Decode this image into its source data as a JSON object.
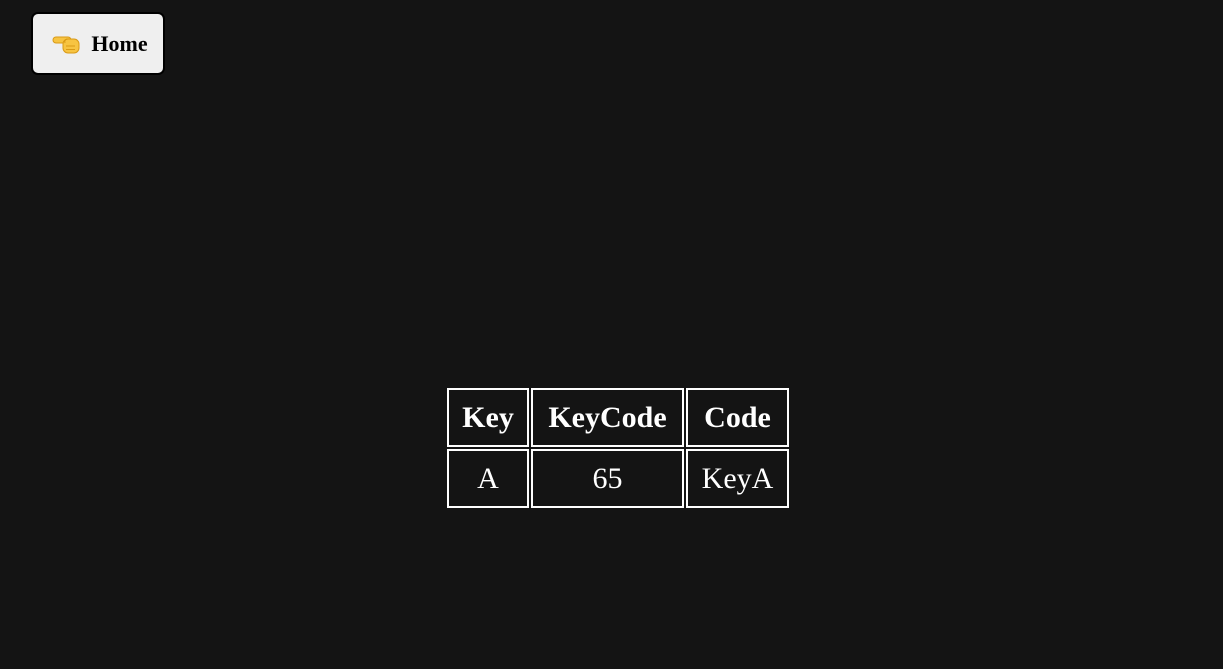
{
  "home_button": {
    "label": "Home",
    "icon": "pointing-hand-icon"
  },
  "key_table": {
    "headers": [
      "Key",
      "KeyCode",
      "Code"
    ],
    "row": [
      "A",
      "65",
      "KeyA"
    ]
  },
  "colors": {
    "background": "#141414",
    "button_background": "#efefef",
    "table_border": "#ffffff",
    "text": "#ffffff"
  }
}
